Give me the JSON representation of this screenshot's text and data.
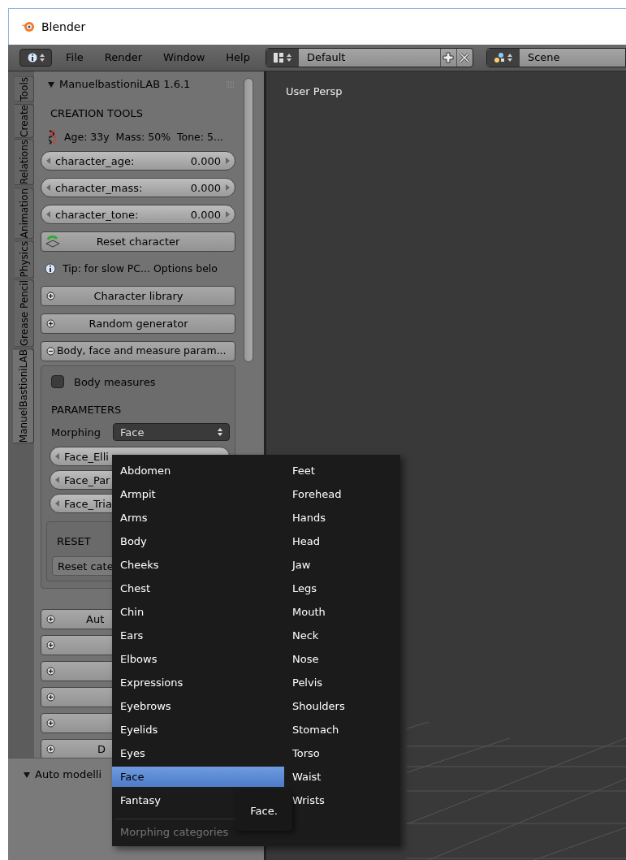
{
  "window": {
    "title": "Blender"
  },
  "header": {
    "menus": [
      "File",
      "Render",
      "Window",
      "Help"
    ],
    "layout": "Default",
    "scene": "Scene"
  },
  "tool_tabs": [
    {
      "label": "Tools",
      "selected": false
    },
    {
      "label": "Create",
      "selected": false
    },
    {
      "label": "Relations",
      "selected": false
    },
    {
      "label": "Animation",
      "selected": false
    },
    {
      "label": "Physics",
      "selected": false
    },
    {
      "label": "Grease Pencil",
      "selected": false
    },
    {
      "label": "ManuelBastioniLAB",
      "selected": true
    }
  ],
  "panel": {
    "title": "ManuelbastioniLAB 1.6.1",
    "expanded": true,
    "section": "CREATION TOOLS",
    "summary": "Age: 33y  Mass: 50%  Tone: 5...",
    "sliders": [
      {
        "label": "character_age:",
        "value": "0.000"
      },
      {
        "label": "character_mass:",
        "value": "0.000"
      },
      {
        "label": "character_tone:",
        "value": "0.000"
      }
    ],
    "reset_button": "Reset character",
    "tip": "Tip: for slow PC... Options belo",
    "sections": [
      {
        "label": "Character library",
        "expanded": false
      },
      {
        "label": "Random generator",
        "expanded": false
      },
      {
        "label": "Body, face and measure param...",
        "expanded": true
      }
    ],
    "body_measures": {
      "label": "Body measures",
      "checked": false
    },
    "parameters_heading": "PARAMETERS",
    "morphing": {
      "label": "Morphing",
      "value": "Face"
    },
    "morph_sliders": [
      "Face_Elli",
      "Face_Par",
      "Face_Tria"
    ],
    "reset_box": {
      "heading": "RESET",
      "button": "Reset cate"
    },
    "collapsed_sections": [
      {
        "label": "Aut",
        "expanded": false
      },
      {
        "expanded": false
      },
      {
        "expanded": false
      },
      {
        "expanded": false
      },
      {
        "expanded": false
      },
      {
        "label": "D",
        "expanded": false
      }
    ]
  },
  "bottom_section": {
    "title": "Auto modelli",
    "expanded": true
  },
  "viewport": {
    "label": "User Persp"
  },
  "morph_menu": {
    "items": [
      {
        "label": "Abdomen",
        "selected": false
      },
      {
        "label": "Armpit",
        "selected": false
      },
      {
        "label": "Arms",
        "selected": false
      },
      {
        "label": "Body",
        "selected": false
      },
      {
        "label": "Cheeks",
        "selected": false
      },
      {
        "label": "Chest",
        "selected": false
      },
      {
        "label": "Chin",
        "selected": false
      },
      {
        "label": "Ears",
        "selected": false
      },
      {
        "label": "Elbows",
        "selected": false
      },
      {
        "label": "Expressions",
        "selected": false
      },
      {
        "label": "Eyebrows",
        "selected": false
      },
      {
        "label": "Eyelids",
        "selected": false
      },
      {
        "label": "Eyes",
        "selected": false
      },
      {
        "label": "Face",
        "selected": true
      },
      {
        "label": "Fantasy",
        "selected": false
      },
      {
        "label": "Feet",
        "selected": false
      },
      {
        "label": "Forehead",
        "selected": false
      },
      {
        "label": "Hands",
        "selected": false
      },
      {
        "label": "Head",
        "selected": false
      },
      {
        "label": "Jaw",
        "selected": false
      },
      {
        "label": "Legs",
        "selected": false
      },
      {
        "label": "Mouth",
        "selected": false
      },
      {
        "label": "Neck",
        "selected": false
      },
      {
        "label": "Nose",
        "selected": false
      },
      {
        "label": "Pelvis",
        "selected": false
      },
      {
        "label": "Shoulders",
        "selected": false
      },
      {
        "label": "Stomach",
        "selected": false
      },
      {
        "label": "Torso",
        "selected": false
      },
      {
        "label": "Waist",
        "selected": false
      },
      {
        "label": "Wrists",
        "selected": false
      }
    ],
    "footer": "Morphing categories"
  },
  "tooltip": "Face."
}
